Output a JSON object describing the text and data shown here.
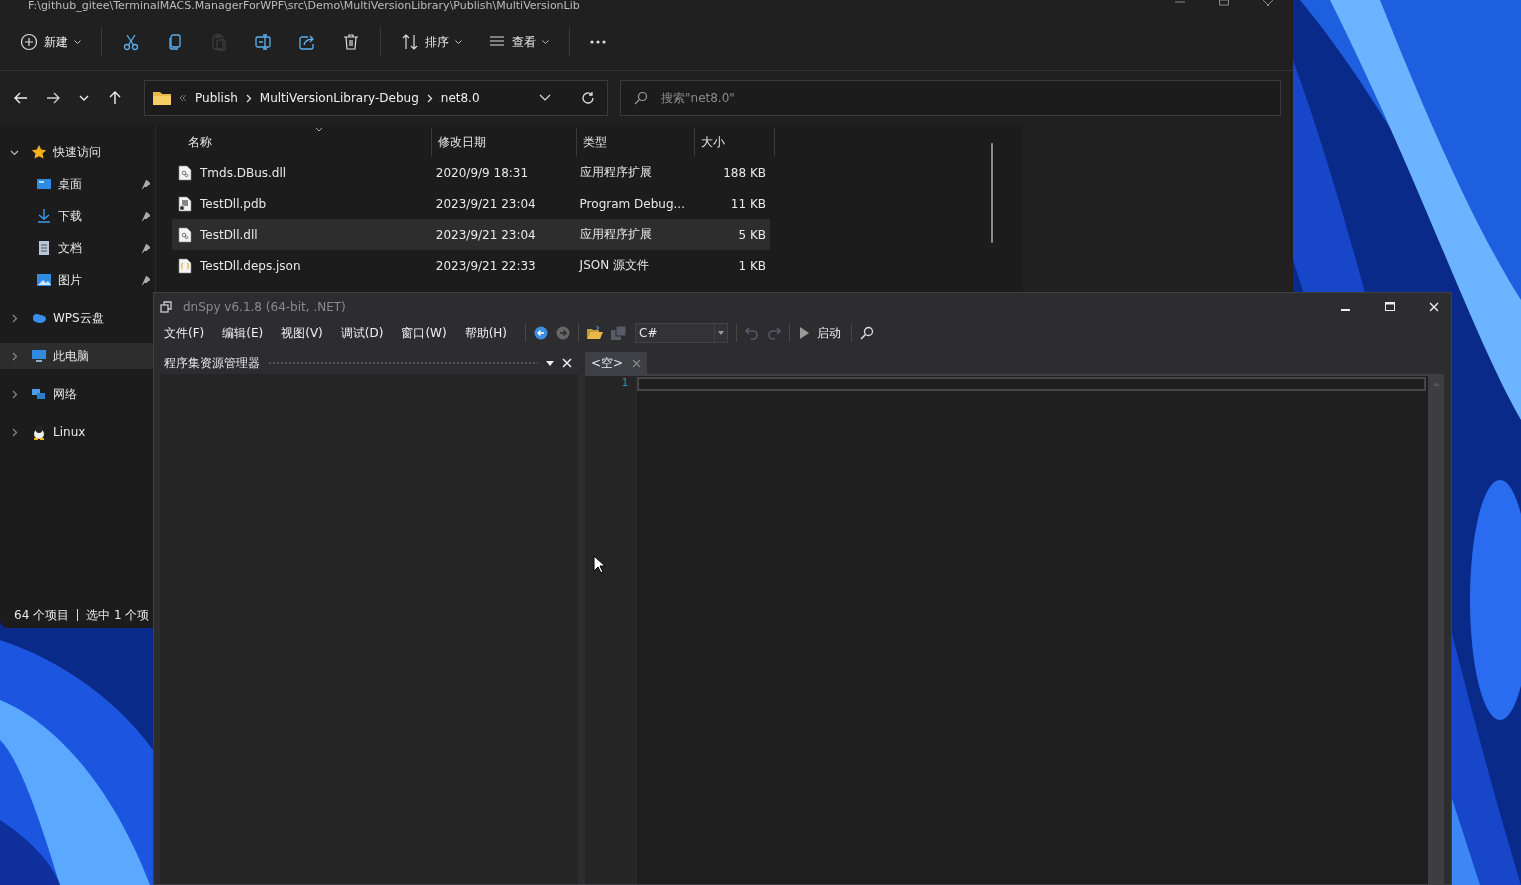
{
  "explorer": {
    "title": "F:\\github_gitee\\TerminalMACS.ManagerForWPF\\src\\Demo\\MultiVersionLibrary\\Publish\\MultiVersionLib",
    "command_bar": [
      {
        "label": "新建",
        "disabled": false
      },
      {
        "disabled": false
      },
      {
        "disabled": false
      },
      {
        "disabled": true
      },
      {
        "disabled": false
      },
      {
        "disabled": false
      },
      {
        "disabled": false
      },
      {
        "label": "排序",
        "disabled": false
      },
      {
        "label": "查看",
        "disabled": false
      },
      {
        "disabled": false
      }
    ],
    "breadcrumbs": [
      "Publish",
      "MultiVersionLibrary-Debug",
      "net8.0"
    ],
    "search": {
      "placeholder": "搜索\"net8.0\""
    },
    "sidebar": [
      {
        "label": "快速访问",
        "expanded": true,
        "selected": false,
        "children": [
          {
            "label": "桌面",
            "pinned": true,
            "selected": false
          },
          {
            "label": "下载",
            "pinned": true,
            "selected": false
          },
          {
            "label": "文档",
            "pinned": true,
            "selected": false
          },
          {
            "label": "图片",
            "pinned": true,
            "selected": false
          }
        ]
      },
      {
        "label": "WPS云盘",
        "expanded": false,
        "selected": false
      },
      {
        "label": "此电脑",
        "expanded": false,
        "selected": true
      },
      {
        "label": "网络",
        "expanded": false,
        "selected": false
      },
      {
        "label": "Linux",
        "expanded": false,
        "selected": false
      }
    ],
    "columns": [
      "名称",
      "修改日期",
      "类型",
      "大小"
    ],
    "files": [
      {
        "kind": "dll",
        "name": "Tmds.DBus.dll",
        "date": "2020/9/9 18:31",
        "type": "应用程序扩展",
        "size": "188 KB",
        "selected": false
      },
      {
        "kind": "pdb",
        "name": "TestDll.pdb",
        "date": "2023/9/21 23:04",
        "type": "Program Debug...",
        "size": "11 KB",
        "selected": false
      },
      {
        "kind": "dll",
        "name": "TestDll.dll",
        "date": "2023/9/21 23:04",
        "type": "应用程序扩展",
        "size": "5 KB",
        "selected": true
      },
      {
        "kind": "json",
        "name": "TestDll.deps.json",
        "date": "2023/9/21 22:33",
        "type": "JSON 源文件",
        "size": "1 KB",
        "selected": false
      }
    ],
    "status_bar": [
      "64 个项目",
      "选中 1 个项"
    ]
  },
  "dnspy": {
    "title": "dnSpy v6.1.8 (64-bit, .NET)",
    "menu": [
      "文件(F)",
      "编辑(E)",
      "视图(V)",
      "调试(D)",
      "窗口(W)",
      "帮助(H)"
    ],
    "toolbar": {
      "back_disabled": false,
      "forward_disabled": true,
      "save_disabled": true,
      "undo_disabled": true,
      "redo_disabled": true,
      "language": "C#",
      "start": "启动"
    },
    "panel": {
      "title": "程序集资源管理器"
    },
    "tab": {
      "label": "<空>"
    },
    "line_numbers": [
      "1"
    ]
  }
}
